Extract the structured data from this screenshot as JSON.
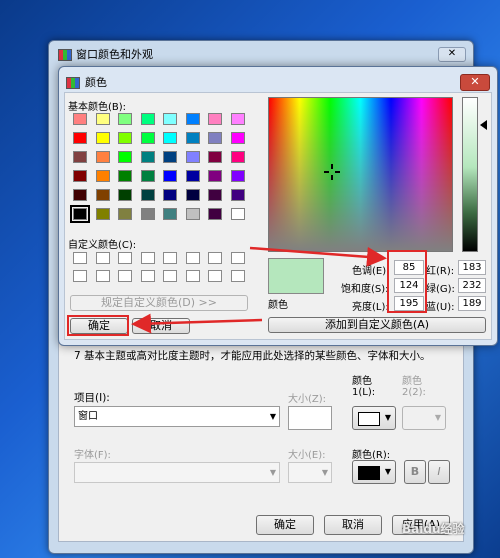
{
  "outer_window": {
    "title": "窗口颜色和外观",
    "close": "✕",
    "info_text": "7 基本主题或高对比度主题时，才能应用此处选择的某些颜色、字体和大小。",
    "item_label": "项目(I):",
    "size_z_label": "大小(Z):",
    "color1_label_line1": "颜色",
    "color1_label_line2": "1(L):",
    "color2_label_line1": "颜色",
    "color2_label_line2": "2(2):",
    "item_value": "窗口",
    "font_label": "字体(F):",
    "size_e_label": "大小(E):",
    "font_color_label": "颜色(R):",
    "bold_label": "B",
    "italic_label": "I",
    "ok_label": "确定",
    "cancel_label": "取消",
    "apply_label": "应用(A)"
  },
  "color_dialog": {
    "title": "颜色",
    "close": "✕",
    "basic_colors_label": "基本颜色(B):",
    "custom_colors_label": "自定义颜色(C):",
    "define_custom_label": "规定自定义颜色(D) >>",
    "ok_label": "确定",
    "cancel_label": "取消",
    "add_custom_label": "添加到自定义颜色(A)",
    "color_solid_label": "颜色",
    "preview_color": "#b5e7bd",
    "hue_label": "色调(E):",
    "sat_label": "饱和度(S):",
    "lum_label": "亮度(L):",
    "red_label": "红(R):",
    "green_label": "绿(G):",
    "blue_label": "蓝(U):",
    "hue": "85",
    "sat": "124",
    "lum": "195",
    "red": "183",
    "green": "232",
    "blue": "189"
  },
  "basic_colors": [
    "#ff8080",
    "#ffff80",
    "#80ff80",
    "#00ff80",
    "#80ffff",
    "#0080ff",
    "#ff80c0",
    "#ff80ff",
    "#ff0000",
    "#ffff00",
    "#80ff00",
    "#00ff40",
    "#00ffff",
    "#0080c0",
    "#8080c0",
    "#ff00ff",
    "#804040",
    "#ff8040",
    "#00ff00",
    "#008080",
    "#004080",
    "#8080ff",
    "#800040",
    "#ff0080",
    "#800000",
    "#ff8000",
    "#008000",
    "#008040",
    "#0000ff",
    "#0000a0",
    "#800080",
    "#8000ff",
    "#400000",
    "#804000",
    "#004000",
    "#004040",
    "#000080",
    "#000040",
    "#400040",
    "#400080",
    "#000000",
    "#808000",
    "#808040",
    "#808080",
    "#408080",
    "#c0c0c0",
    "#400040",
    "#ffffff"
  ],
  "watermark": "Baidu经验",
  "colors": {
    "red_highlight": "#e02828"
  }
}
